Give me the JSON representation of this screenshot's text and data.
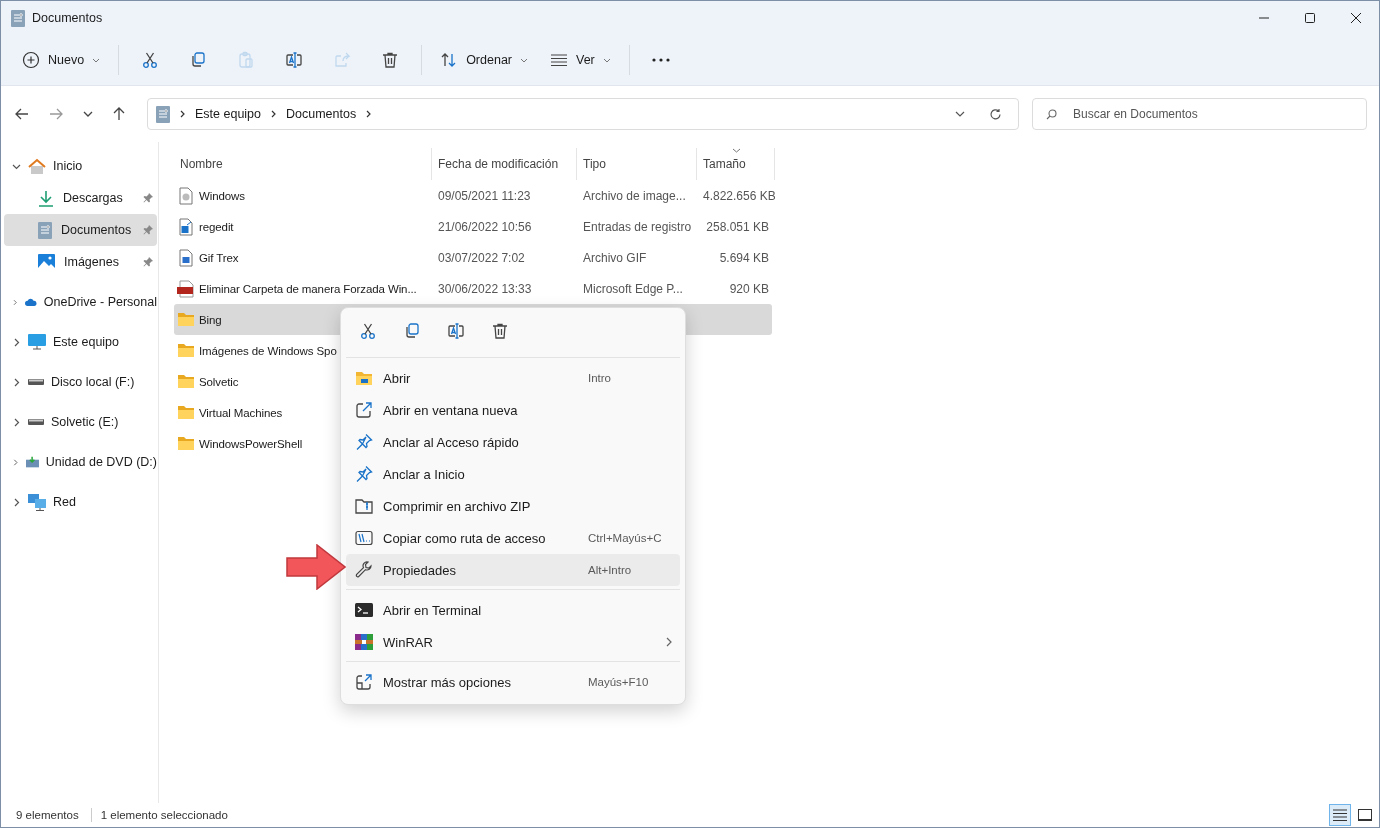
{
  "window": {
    "title": "Documentos"
  },
  "toolbar": [
    {
      "kind": "new",
      "label": "Nuevo",
      "disabled": false,
      "dropdown": true
    },
    {
      "kind": "cut",
      "disabled": false
    },
    {
      "kind": "copy",
      "disabled": false
    },
    {
      "kind": "paste",
      "disabled": true
    },
    {
      "kind": "rename",
      "disabled": false
    },
    {
      "kind": "share",
      "disabled": true
    },
    {
      "kind": "delete",
      "disabled": false
    },
    {
      "kind": "sort",
      "label": "Ordenar",
      "disabled": false,
      "dropdown": true
    },
    {
      "kind": "view",
      "label": "Ver",
      "disabled": false,
      "dropdown": true
    },
    {
      "kind": "more",
      "disabled": false
    }
  ],
  "address": {
    "breadcrumbs": [
      "Este equipo",
      "Documentos"
    ]
  },
  "search": {
    "placeholder": "Buscar en Documentos"
  },
  "sidebar": {
    "items": [
      {
        "label": "Inicio",
        "kind": "home",
        "expanded": true,
        "selected": false,
        "children": [
          {
            "label": "Descargas",
            "kind": "downloads",
            "pinned": true,
            "selected": false
          },
          {
            "label": "Documentos",
            "kind": "documents",
            "pinned": true,
            "selected": true
          },
          {
            "label": "Imágenes",
            "kind": "pictures",
            "pinned": true,
            "selected": false
          }
        ]
      },
      {
        "label": "OneDrive - Personal",
        "kind": "cloud",
        "expanded": false,
        "selected": false
      },
      {
        "label": "Este equipo",
        "kind": "computer",
        "expanded": false,
        "selected": false
      },
      {
        "label": "Disco local (F:)",
        "kind": "drive",
        "expanded": false,
        "selected": false
      },
      {
        "label": "Solvetic (E:)",
        "kind": "drive",
        "expanded": false,
        "selected": false
      },
      {
        "label": "Unidad de DVD (D:)",
        "kind": "dvd",
        "expanded": false,
        "selected": false
      },
      {
        "label": "Red",
        "kind": "network",
        "expanded": false,
        "selected": false
      }
    ]
  },
  "table": {
    "columns": [
      "Nombre",
      "Fecha de modificación",
      "Tipo",
      "Tamaño"
    ],
    "rows": [
      {
        "kind": "disc-image",
        "name": "Windows",
        "date": "09/05/2021 11:23",
        "type": "Archivo de image...",
        "size": "4.822.656 KB",
        "selected": false
      },
      {
        "kind": "registry",
        "name": "regedit",
        "date": "21/06/2022 10:56",
        "type": "Entradas de registro",
        "size": "258.051 KB",
        "selected": false
      },
      {
        "kind": "gif",
        "name": "Gif Trex",
        "date": "03/07/2022 7:02",
        "type": "Archivo GIF",
        "size": "5.694 KB",
        "selected": false
      },
      {
        "kind": "pdf",
        "name": "Eliminar Carpeta de manera Forzada Win...",
        "date": "30/06/2022 13:33",
        "type": "Microsoft Edge P...",
        "size": "920 KB",
        "selected": false
      },
      {
        "kind": "folder",
        "name": "Bing",
        "selected": true
      },
      {
        "kind": "folder",
        "name": "Imágenes de Windows Spo",
        "selected": false
      },
      {
        "kind": "folder",
        "name": "Solvetic",
        "selected": false
      },
      {
        "kind": "folder",
        "name": "Virtual Machines",
        "selected": false
      },
      {
        "kind": "folder",
        "name": "WindowsPowerShell",
        "selected": false
      }
    ]
  },
  "context_menu": {
    "quick_actions": [
      {
        "kind": "cut"
      },
      {
        "kind": "copy"
      },
      {
        "kind": "rename"
      },
      {
        "kind": "delete"
      }
    ],
    "sections": [
      [
        {
          "kind": "open",
          "label": "Abrir",
          "shortcut": "Intro",
          "selected": false
        },
        {
          "kind": "new-window",
          "label": "Abrir en ventana nueva",
          "selected": false
        },
        {
          "kind": "pin",
          "label": "Anclar al Acceso rápido",
          "selected": false
        },
        {
          "kind": "pin",
          "label": "Anclar a Inicio",
          "selected": false
        },
        {
          "kind": "zip",
          "label": "Comprimir en archivo ZIP",
          "selected": false
        },
        {
          "kind": "path",
          "label": "Copiar como ruta de acceso",
          "shortcut": "Ctrl+Mayús+C",
          "selected": false
        },
        {
          "kind": "properties",
          "label": "Propiedades",
          "shortcut": "Alt+Intro",
          "selected": true
        }
      ],
      [
        {
          "kind": "terminal",
          "label": "Abrir en Terminal",
          "selected": false
        },
        {
          "kind": "winrar",
          "label": "WinRAR",
          "submenu": true,
          "selected": false
        }
      ],
      [
        {
          "kind": "more-options",
          "label": "Mostrar más opciones",
          "shortcut": "Mayús+F10",
          "selected": false
        }
      ]
    ]
  },
  "status_bar": {
    "count": "9 elementos",
    "selection": "1 elemento seleccionado",
    "views": [
      {
        "kind": "details",
        "selected": true
      },
      {
        "kind": "tiles",
        "selected": false
      }
    ]
  }
}
